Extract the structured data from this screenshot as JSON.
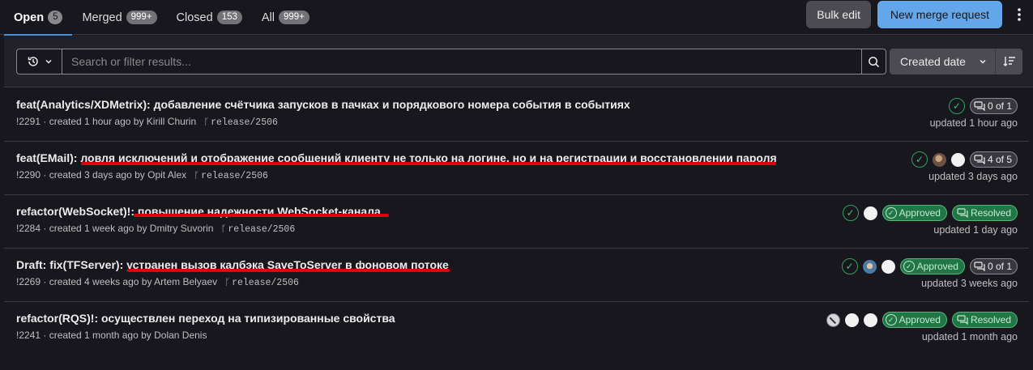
{
  "tabs": [
    {
      "label": "Open",
      "count": "5"
    },
    {
      "label": "Merged",
      "count": "999+"
    },
    {
      "label": "Closed",
      "count": "153"
    },
    {
      "label": "All",
      "count": "999+"
    }
  ],
  "toolbar": {
    "bulk_edit": "Bulk edit",
    "new_mr": "New merge request",
    "more_icon": "vertical-ellipsis-icon"
  },
  "search": {
    "placeholder": "Search or filter results...",
    "value": ""
  },
  "sort": {
    "label": "Created date"
  },
  "merge_requests": [
    {
      "title": "feat(Analytics/XDMetrix): добавление счётчика запусков в пачках и порядкового номера события в событиях",
      "meta": "!2291 · created 1 hour ago by Kirill Churin",
      "branch": "release/2506",
      "updated": "updated 1 hour ago",
      "threads": "0 of 1"
    },
    {
      "title": "feat(EMail): ловля исключений и отображение сообщений клиенту не только на логине, но и на регистрации и восстановлении пароля",
      "meta": "!2290 · created 3 days ago by Opit Alex",
      "branch": "release/2506",
      "updated": "updated 3 days ago",
      "threads": "4 of 5"
    },
    {
      "title": "refactor(WebSocket)!: повышение надежности WebSocket-канала",
      "meta": "!2284 · created 1 week ago by Dmitry Suvorin",
      "branch": "release/2506",
      "updated": "updated 1 day ago",
      "approved": "Approved",
      "resolved": "Resolved"
    },
    {
      "title": "Draft: fix(TFServer): устранен вызов калбэка SaveToServer в фоновом потоке",
      "meta": "!2269 · created 4 weeks ago by Artem Belyaev",
      "branch": "release/2506",
      "updated": "updated 3 weeks ago",
      "approved": "Approved",
      "threads": "0 of 1"
    },
    {
      "title": "refactor(RQS)!: осуществлен переход на типизированные свойства",
      "meta": "!2241 · created 1 month ago by Dolan Denis",
      "updated": "updated 1 month ago",
      "approved": "Approved",
      "resolved": "Resolved"
    }
  ],
  "colors": {
    "accent": "#428fdc",
    "approved_bg": "#217645",
    "annotation": "#e0000b"
  }
}
